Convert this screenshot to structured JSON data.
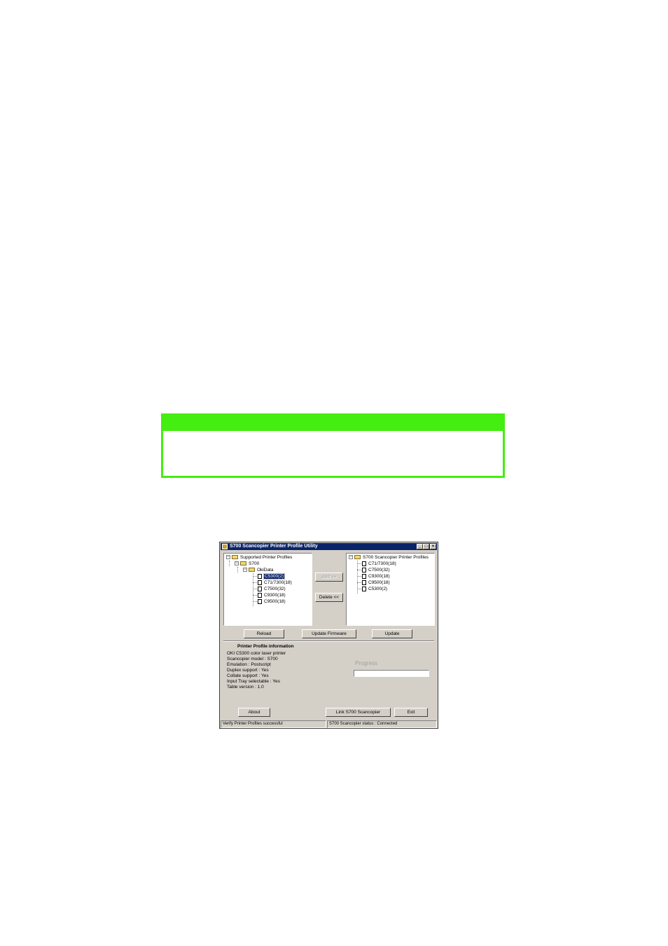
{
  "note_box": {
    "border_color": "#44ee11"
  },
  "window": {
    "title": "S700 Scancopier Printer Profile Utility",
    "controls": {
      "minimize": "_",
      "maximize": "□",
      "close": "×"
    }
  },
  "left_tree": {
    "root": "Supported Printer Profiles",
    "model": "S700",
    "vendor": "OkiData",
    "items": [
      "C5300(2)",
      "C71/7300(18)",
      "C7500(32)",
      "C9300(18)",
      "C9500(18)"
    ],
    "selected_index": 0
  },
  "right_tree": {
    "root": "S700 Scancopier Printer Profiles",
    "items": [
      "C71/7300(18)",
      "C7500(32)",
      "C9300(18)",
      "C9500(18)",
      "C5300(2)"
    ]
  },
  "buttons": {
    "add": "Add >>",
    "delete": "Delete <<",
    "reload": "Reload",
    "update_firmware": "Update Firmware",
    "update": "Update",
    "about": "About",
    "link": "Link S700 Scancopier",
    "exit": "Exit"
  },
  "info": {
    "heading": "Printer Profile information",
    "lines": [
      "OKI C5300 color laser printer",
      "Scancopier model : S700",
      "Emulation : Postscript",
      "Duplex support : Yes",
      "Collate support : Yes",
      "Input Tray selectable : Yes",
      "Table version : 1.0"
    ]
  },
  "progress": {
    "label": "Progress",
    "value": 0
  },
  "status_bar": {
    "left": "Verify Printer Profiles successful",
    "right": "S700 Scancopier status : Connected"
  }
}
